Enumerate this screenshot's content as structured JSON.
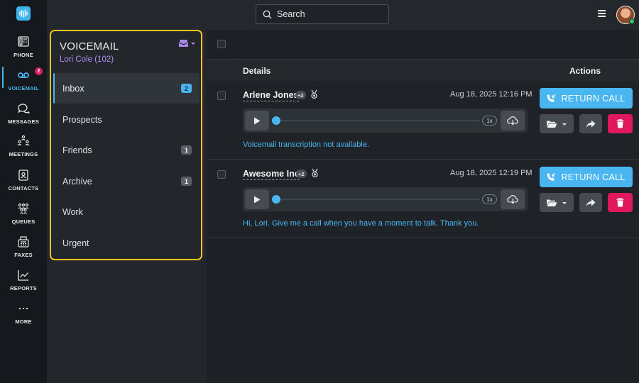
{
  "app": {
    "accent": "#49b6f2",
    "alert": "#e0185c",
    "highlight": "#f3c41b"
  },
  "rail": {
    "items": [
      {
        "label": "PHONE",
        "icon": "phone-icon"
      },
      {
        "label": "VOICEMAIL",
        "icon": "voicemail-icon",
        "badge": "2"
      },
      {
        "label": "MESSAGES",
        "icon": "chat-icon"
      },
      {
        "label": "MEETINGS",
        "icon": "meetings-icon"
      },
      {
        "label": "CONTACTS",
        "icon": "contacts-icon"
      },
      {
        "label": "QUEUES",
        "icon": "queues-icon"
      },
      {
        "label": "FAXES",
        "icon": "fax-icon"
      },
      {
        "label": "REPORTS",
        "icon": "reports-icon"
      },
      {
        "label": "MORE",
        "icon": "more-icon"
      }
    ]
  },
  "topbar": {
    "search_placeholder": "Search"
  },
  "folders": {
    "title": "VOICEMAIL",
    "user": "Lori Cole (102)",
    "items": [
      {
        "label": "Inbox",
        "count": "2"
      },
      {
        "label": "Prospects",
        "count": ""
      },
      {
        "label": "Friends",
        "count": "1"
      },
      {
        "label": "Archive",
        "count": "1"
      },
      {
        "label": "Work",
        "count": ""
      },
      {
        "label": "Urgent",
        "count": ""
      }
    ]
  },
  "table": {
    "col_details": "Details",
    "col_actions": "Actions"
  },
  "voicemails": [
    {
      "caller": "Arlene Jones",
      "extra": "+2",
      "date": "Aug 18, 2025 12:16 PM",
      "speed": "1x",
      "transcript": "Voicemail transcription not available.",
      "return_label": "RETURN CALL"
    },
    {
      "caller": "Awesome Inc",
      "extra": "+2",
      "date": "Aug 18, 2025 12:19 PM",
      "speed": "1x",
      "transcript": "Hi, Lori. Give me a call when you have a moment to talk. Thank you.",
      "return_label": "RETURN CALL"
    }
  ]
}
